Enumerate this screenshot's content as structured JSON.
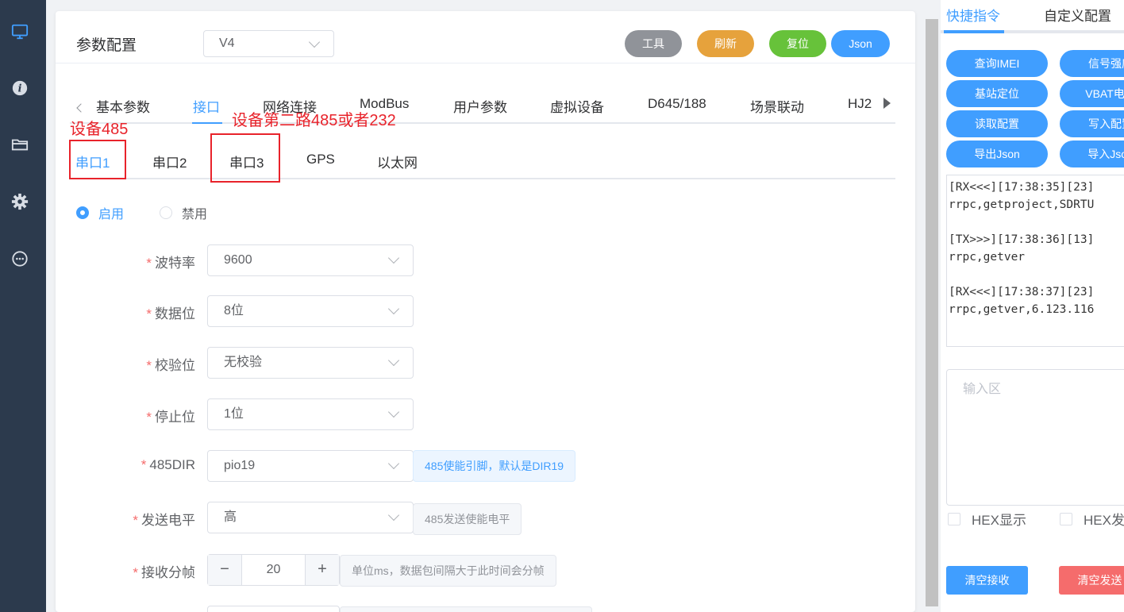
{
  "nav": {
    "icons": [
      "monitor-icon",
      "info-icon",
      "folder-icon",
      "gear-icon",
      "chat-icon"
    ],
    "active_color": "#409eff"
  },
  "header": {
    "title": "参数配置",
    "version": "V4",
    "buttons": {
      "tools": "工具",
      "refresh": "刷新",
      "reset": "复位",
      "json": "Json"
    }
  },
  "top_tabs": [
    "基本参数",
    "接口",
    "网络连接",
    "ModBus",
    "用户参数",
    "虚拟设备",
    "D645/188",
    "场景联动",
    "HJ2"
  ],
  "top_tab_active": "接口",
  "sub_tabs": [
    "串口1",
    "串口2",
    "串口3",
    "GPS",
    "以太网"
  ],
  "sub_tab_active": "串口1",
  "annotations": {
    "port1": "设备485",
    "port3": "设备第二路485或者232"
  },
  "enable": {
    "on": "启用",
    "off": "禁用",
    "selected": "启用"
  },
  "form": {
    "baud": {
      "label": "波特率",
      "value": "9600"
    },
    "databits": {
      "label": "数据位",
      "value": "8位"
    },
    "parity": {
      "label": "校验位",
      "value": "无校验"
    },
    "stopbits": {
      "label": "停止位",
      "value": "1位"
    },
    "dir": {
      "label": "485DIR",
      "value": "pio19",
      "hint": "485使能引脚，默认是DIR19"
    },
    "level": {
      "label": "发送电平",
      "value": "高",
      "hint": "485发送使能电平"
    },
    "frame": {
      "label": "接收分帧",
      "value": "20",
      "hint": "单位ms，数据包间隔大于此时间会分帧",
      "minus": "−",
      "plus": "+"
    }
  },
  "right": {
    "tabs": [
      "快捷指令",
      "自定义配置"
    ],
    "quick_buttons": [
      "查询IMEI",
      "信号强度",
      "基站定位",
      "VBAT电压",
      "读取配置",
      "写入配置",
      "导出Json",
      "导入Json"
    ],
    "log": "[RX<<<][17:38:35][23]\nrrpc,getproject,SDRTU\n\n[TX>>>][17:38:36][13]\nrrpc,getver\n\n[RX<<<][17:38:37][23]\nrrpc,getver,6.123.116",
    "input_placeholder": "输入区",
    "hex_show": "HEX显示",
    "hex_send": "HEX发送",
    "clear_recv": "清空接收",
    "clear_send": "清空发送"
  }
}
